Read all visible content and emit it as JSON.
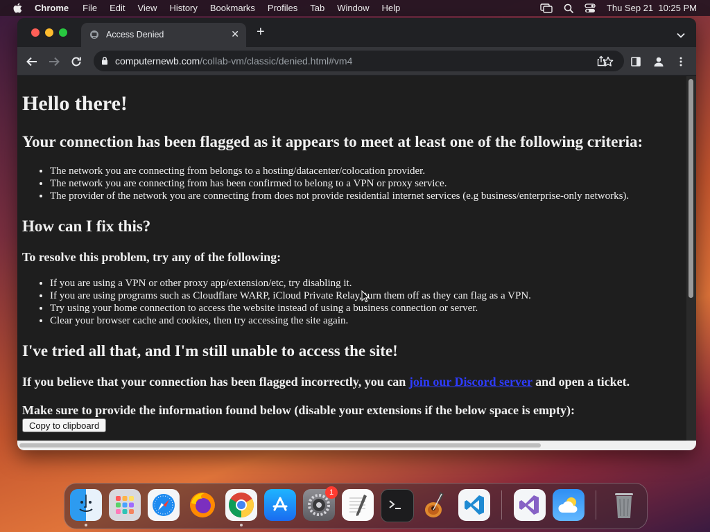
{
  "menubar": {
    "app_name": "Chrome",
    "menus": [
      "File",
      "Edit",
      "View",
      "History",
      "Bookmarks",
      "Profiles",
      "Tab",
      "Window",
      "Help"
    ],
    "clock": "Thu Sep 21  10:25 PM"
  },
  "browser": {
    "tab_title": "Access Denied",
    "url_host": "computernewb.com",
    "url_path": "/collab-vm/classic/denied.html#vm4"
  },
  "page": {
    "heading": "Hello there!",
    "subheading": "Your connection has been flagged as it appears to meet at least one of the following criteria:",
    "criteria": [
      "The network you are connecting from belongs to a hosting/datacenter/colocation provider.",
      "The network you are connecting from has been confirmed to belong to a VPN or proxy service.",
      "The provider of the network you are connecting from does not provide residential internet services (e.g business/enterprise-only networks)."
    ],
    "fix_heading": "How can I fix this?",
    "resolve_heading": "To resolve this problem, try any of the following:",
    "fixes": [
      "If you are using a VPN or other proxy app/extension/etc, try disabling it.",
      "If you are using programs such as Cloudflare WARP, iCloud Private Relay, turn them off as they can flag as a VPN.",
      "Try using your home connection to access the website instead of using a business connection or server.",
      "Clear your browser cache and cookies, then try accessing the site again."
    ],
    "tried_heading": "I've tried all that, and I'm still unable to access the site!",
    "flagged_prefix": "If you believe that your connection has been flagged incorrectly, you can ",
    "discord_link": "join our Discord server",
    "flagged_suffix": " and open a ticket.",
    "info_heading": "Make sure to provide the information found below (disable your extensions if the below space is empty):",
    "copy_button": "Copy to clipboard"
  },
  "dock": {
    "apps": [
      "Finder",
      "Launchpad",
      "Safari",
      "Firefox",
      "Chrome",
      "App Store",
      "System Settings",
      "TextEdit",
      "Terminal",
      "GarageBand",
      "Visual Studio Code",
      "Visual Studio",
      "Weather",
      "Trash"
    ],
    "settings_badge": "1"
  }
}
